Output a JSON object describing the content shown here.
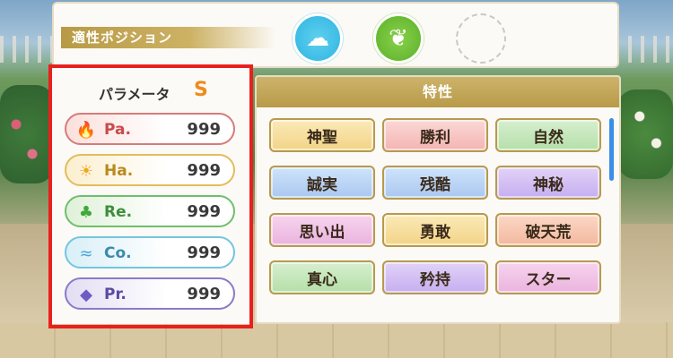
{
  "position_panel": {
    "label": "適性ポジション",
    "icons": [
      "cloud-icon",
      "leaf-sprite-icon",
      "empty-slot-icon"
    ]
  },
  "parameters": {
    "title": "パラメータ",
    "rank": "S",
    "stats": [
      {
        "name": "Pa.",
        "value": "999",
        "icon": "flame-icon",
        "color": "#d77b7b"
      },
      {
        "name": "Ha.",
        "value": "999",
        "icon": "sun-icon",
        "color": "#e2bd5c"
      },
      {
        "name": "Re.",
        "value": "999",
        "icon": "clover-icon",
        "color": "#6fbf6c"
      },
      {
        "name": "Co.",
        "value": "999",
        "icon": "wave-icon",
        "color": "#74c5df"
      },
      {
        "name": "Pr.",
        "value": "999",
        "icon": "diamond-icon",
        "color": "#8a7bc8"
      }
    ]
  },
  "traits": {
    "title": "特性",
    "items": [
      {
        "label": "神聖",
        "style": "gold"
      },
      {
        "label": "勝利",
        "style": "pink"
      },
      {
        "label": "自然",
        "style": "green"
      },
      {
        "label": "誠実",
        "style": "blue"
      },
      {
        "label": "残酷",
        "style": "blue"
      },
      {
        "label": "神秘",
        "style": "purple"
      },
      {
        "label": "思い出",
        "style": "rose"
      },
      {
        "label": "勇敢",
        "style": "gold"
      },
      {
        "label": "破天荒",
        "style": "orange"
      },
      {
        "label": "真心",
        "style": "green"
      },
      {
        "label": "矜持",
        "style": "purple"
      },
      {
        "label": "スター",
        "style": "rose"
      }
    ]
  }
}
